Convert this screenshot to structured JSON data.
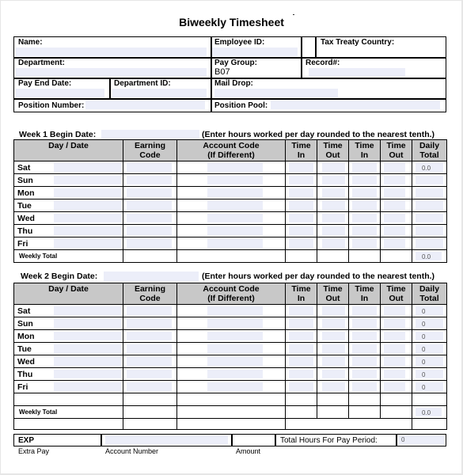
{
  "title": "Biweekly Timesheet",
  "header_fields": {
    "name": {
      "label": "Name:",
      "value": ""
    },
    "employee_id": {
      "label": "Employee ID:",
      "value": ""
    },
    "tax_treaty_country": {
      "label": "Tax Treaty Country:",
      "value": ""
    },
    "department": {
      "label": "Department:",
      "value": ""
    },
    "pay_group": {
      "label": "Pay Group:",
      "value": "B07"
    },
    "record": {
      "label": "Record#:",
      "value": ""
    },
    "pay_end_date": {
      "label": "Pay End Date:",
      "value": ""
    },
    "department_id": {
      "label": "Department ID:",
      "value": ""
    },
    "mail_drop": {
      "label": "Mail Drop:",
      "value": ""
    },
    "position_number": {
      "label": "Position Number:",
      "value": ""
    },
    "position_pool": {
      "label": "Position Pool:",
      "value": ""
    }
  },
  "instruction": "(Enter hours worked per day rounded to the nearest tenth.)",
  "columns": [
    "Day / Date",
    "Earning Code",
    "Account Code (If Different)",
    "Time In",
    "Time Out",
    "Time In",
    "Time Out",
    "Daily Total"
  ],
  "column_lines": [
    [
      "Day / Date"
    ],
    [
      "Earning",
      "Code"
    ],
    [
      "Account Code",
      "(If Different)"
    ],
    [
      "Time",
      "In"
    ],
    [
      "Time",
      "Out"
    ],
    [
      "Time",
      "In"
    ],
    [
      "Time",
      "Out"
    ],
    [
      "Daily",
      "Total"
    ]
  ],
  "weeks": [
    {
      "label": "Week 1 Begin Date:",
      "begin_date": "",
      "days": [
        {
          "day": "Sat",
          "daily_total": "0.0"
        },
        {
          "day": "Sun",
          "daily_total": ""
        },
        {
          "day": "Mon",
          "daily_total": ""
        },
        {
          "day": "Tue",
          "daily_total": ""
        },
        {
          "day": "Wed",
          "daily_total": ""
        },
        {
          "day": "Thu",
          "daily_total": ""
        },
        {
          "day": "Fri",
          "daily_total": ""
        }
      ],
      "weekly_total_label": "Weekly Total",
      "weekly_total": "0.0"
    },
    {
      "label": "Week 2 Begin Date:",
      "begin_date": "",
      "days": [
        {
          "day": "Sat",
          "daily_total": "0"
        },
        {
          "day": "Sun",
          "daily_total": "0"
        },
        {
          "day": "Mon",
          "daily_total": "0"
        },
        {
          "day": "Tue",
          "daily_total": "0"
        },
        {
          "day": "Wed",
          "daily_total": "0"
        },
        {
          "day": "Thu",
          "daily_total": "0"
        },
        {
          "day": "Fri",
          "daily_total": "0"
        }
      ],
      "weekly_total_label": "Weekly Total",
      "weekly_total": "0.0"
    }
  ],
  "footer": {
    "exp_label": "EXP",
    "account_number_value": "",
    "amount_value": "",
    "total_hours_label": "Total Hours For Pay Period:",
    "total_hours_value": "0",
    "extra_pay_label": "Extra Pay",
    "account_number_label": "Account Number",
    "amount_label": "Amount"
  }
}
